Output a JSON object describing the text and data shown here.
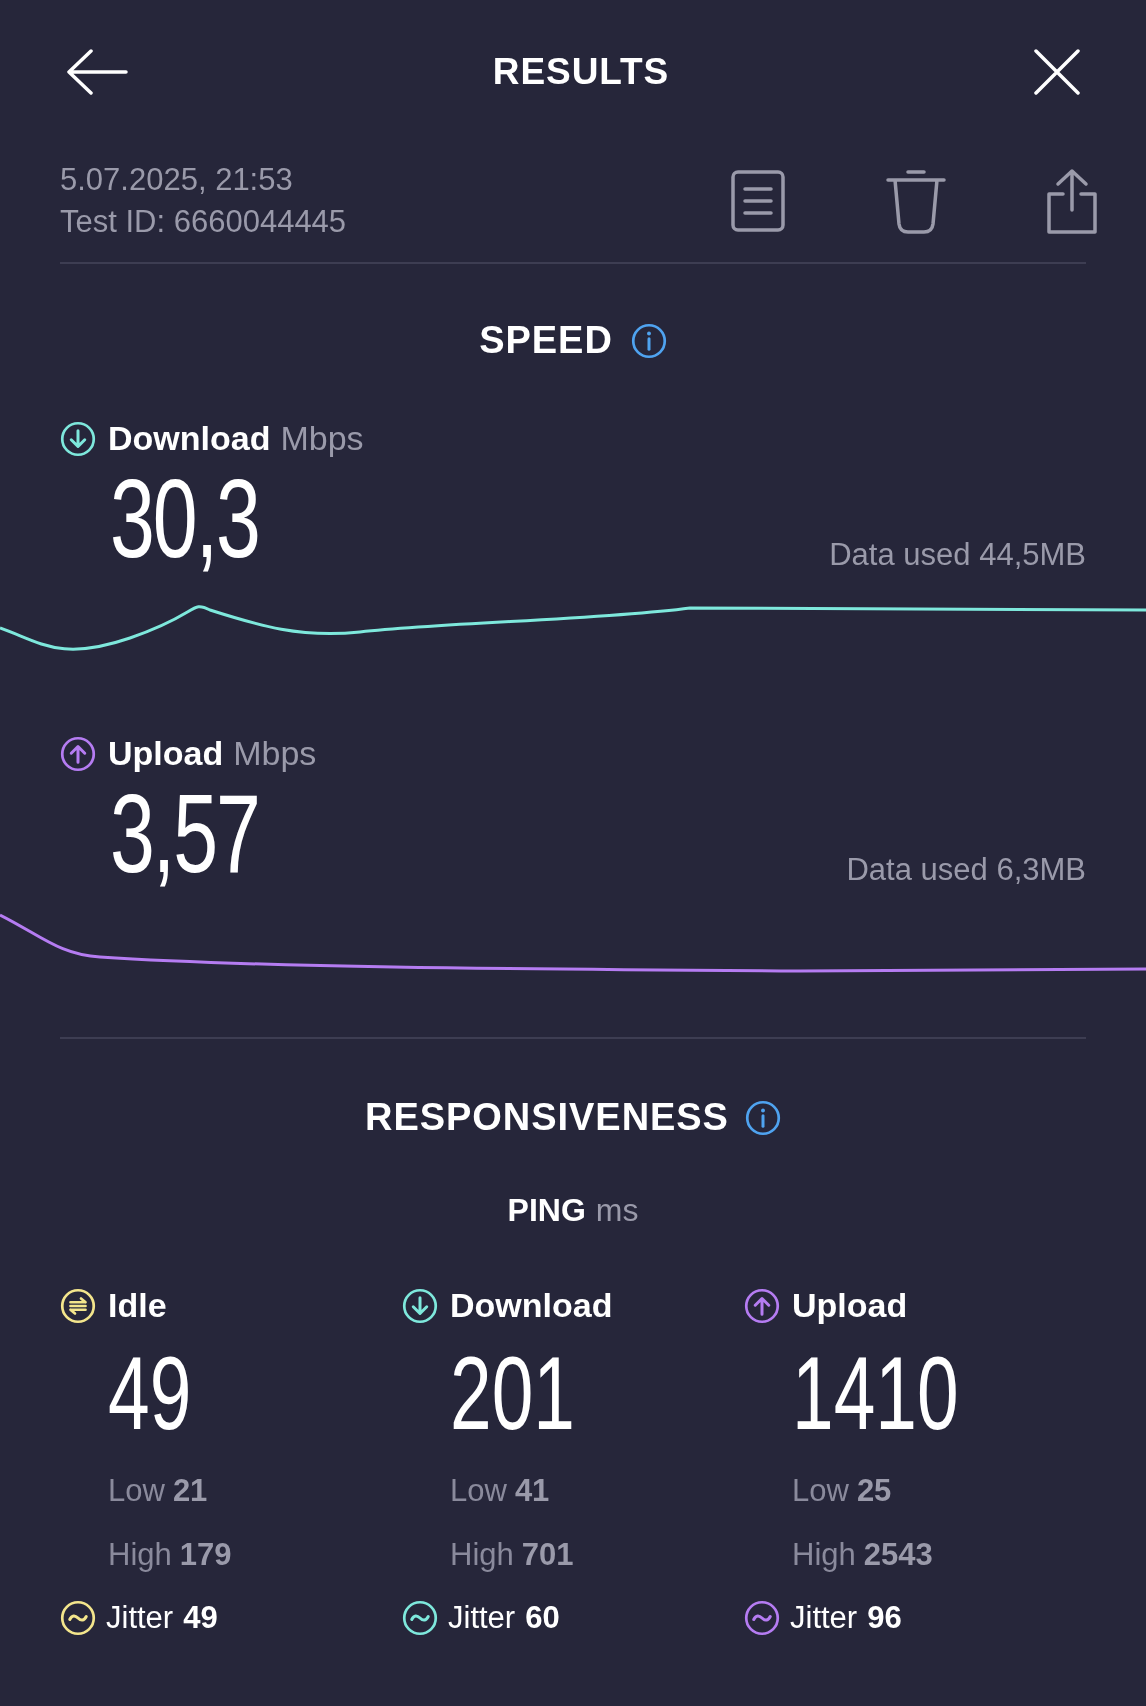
{
  "header": {
    "title": "RESULTS"
  },
  "meta": {
    "date": "5.07.2025, 21:53",
    "test_id": "Test ID: 6660044445"
  },
  "speed": {
    "title": "SPEED",
    "metrics": [
      {
        "kind": "download",
        "label": "Download",
        "unit": "Mbps",
        "value": "30,3",
        "data_used": "Data used 44,5MB"
      },
      {
        "kind": "upload",
        "label": "Upload",
        "unit": "Mbps",
        "value": "3,57",
        "data_used": "Data used 6,3MB"
      }
    ]
  },
  "responsiveness": {
    "title": "RESPONSIVENESS",
    "ping_label": "PING",
    "ping_unit": "ms",
    "columns": [
      {
        "kind": "idle",
        "label": "Idle",
        "value": "49",
        "low_label": "Low",
        "low": "21",
        "high_label": "High",
        "high": "179",
        "jitter_label": "Jitter",
        "jitter": "49"
      },
      {
        "kind": "download",
        "label": "Download",
        "value": "201",
        "low_label": "Low",
        "low": "41",
        "high_label": "High",
        "high": "701",
        "jitter_label": "Jitter",
        "jitter": "60"
      },
      {
        "kind": "upload",
        "label": "Upload",
        "value": "1410",
        "low_label": "Low",
        "low": "25",
        "high_label": "High",
        "high": "2543",
        "jitter_label": "Jitter",
        "jitter": "96"
      }
    ]
  }
}
